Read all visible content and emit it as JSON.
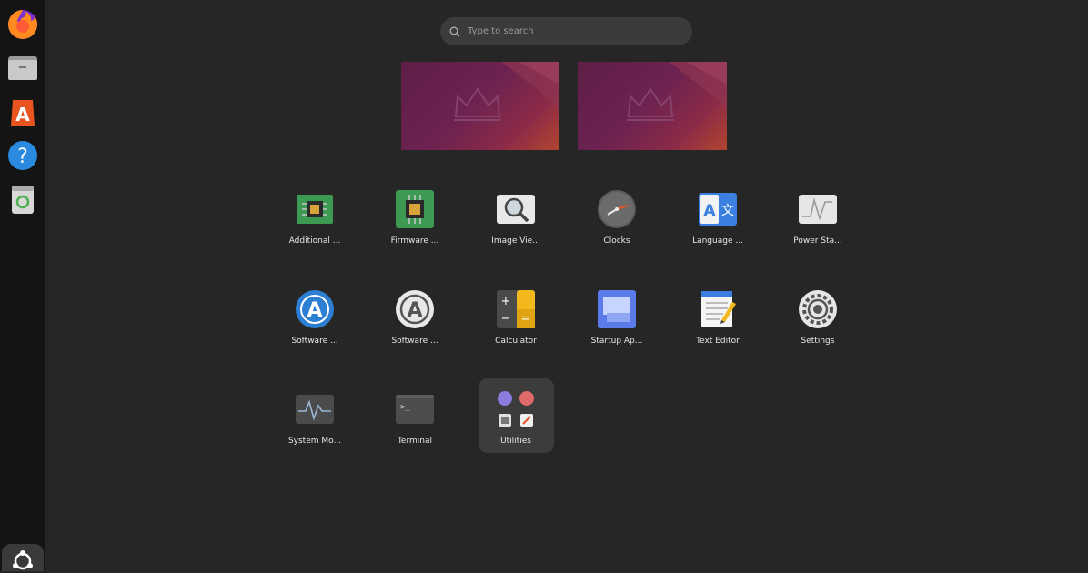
{
  "search": {
    "placeholder": "Type to search"
  },
  "dock": {
    "items": [
      {
        "icon": "firefox-icon"
      },
      {
        "icon": "files-icon"
      },
      {
        "icon": "app-center-icon"
      },
      {
        "icon": "help-icon"
      },
      {
        "icon": "trash-icon"
      }
    ],
    "show_apps_icon": "ubuntu-logo-icon"
  },
  "workspaces": [
    {
      "name": "workspace-1"
    },
    {
      "name": "workspace-2"
    }
  ],
  "apps": [
    {
      "label": "Additional ...",
      "icon": "chip-icon"
    },
    {
      "label": "Firmware ...",
      "icon": "firmware-chip-icon"
    },
    {
      "label": "Image Vie...",
      "icon": "magnifier-icon"
    },
    {
      "label": "Clocks",
      "icon": "clock-icon"
    },
    {
      "label": "Language ...",
      "icon": "language-icon"
    },
    {
      "label": "Power Sta...",
      "icon": "power-graph-icon"
    },
    {
      "label": "Software ...",
      "icon": "software-updater-icon"
    },
    {
      "label": "Software ...",
      "icon": "software-properties-icon"
    },
    {
      "label": "Calculator",
      "icon": "calculator-icon"
    },
    {
      "label": "Startup Ap...",
      "icon": "startup-apps-icon"
    },
    {
      "label": "Text Editor",
      "icon": "text-editor-icon"
    },
    {
      "label": "Settings",
      "icon": "settings-gear-icon"
    },
    {
      "label": "System Mo...",
      "icon": "system-monitor-icon"
    },
    {
      "label": "Terminal",
      "icon": "terminal-icon"
    },
    {
      "label": "Utilities",
      "icon": "folder-icon"
    }
  ],
  "colors": {
    "background": "#262626",
    "dock": "#141414",
    "search": "#3b3b3b",
    "folder": "#3c3c3c",
    "accent": "#e95420"
  }
}
